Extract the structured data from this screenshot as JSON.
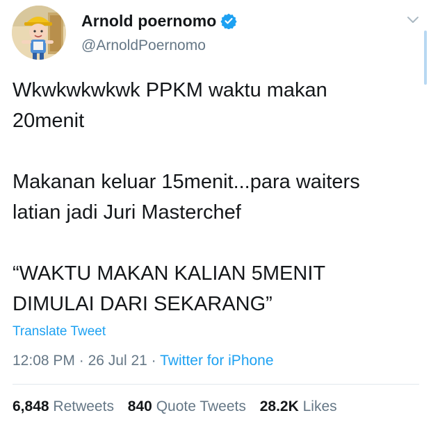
{
  "author": {
    "display_name": "Arnold poernomo",
    "handle": "@ArnoldPoernomo",
    "verified": true,
    "avatar_icon": "cartoon-boy-avatar"
  },
  "header": {
    "menu_icon": "chevron-down-icon"
  },
  "tweet": {
    "paragraphs": [
      "Wkwkwkwkwk PPKM waktu makan\n20menit",
      "Makanan keluar 15menit...para waiters\nlatian jadi Juri Masterchef",
      "“WAKTU MAKAN KALIAN 5MENIT\nDIMULAI DARI SEKARANG”"
    ],
    "translate_label": "Translate Tweet",
    "time": "12:08 PM",
    "date": "26 Jul 21",
    "separator": "·",
    "source": "Twitter for iPhone"
  },
  "stats": {
    "retweets_count": "6,848",
    "retweets_label": "Retweets",
    "quotes_count": "840",
    "quotes_label": "Quote Tweets",
    "likes_count": "28.2K",
    "likes_label": "Likes"
  },
  "colors": {
    "accent": "#1da1f2",
    "text": "#14171a",
    "muted": "#657786",
    "divider": "#e1e8ed"
  }
}
